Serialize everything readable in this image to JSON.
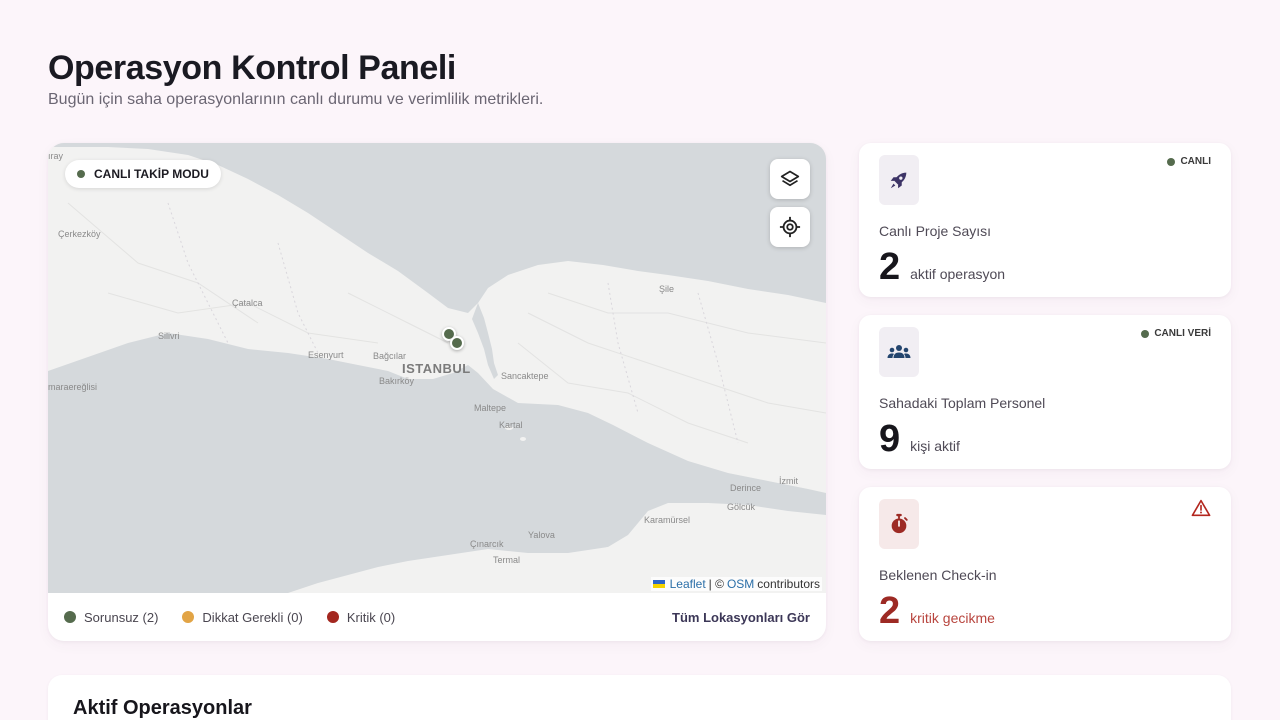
{
  "header": {
    "title": "Operasyon Kontrol Paneli",
    "subtitle": "Bugün için saha operasyonlarının canlı durumu ve verimlilik metrikleri."
  },
  "map": {
    "live_mode_label": "CANLI TAKİP MODU",
    "layers_button": "layers-icon",
    "locate_button": "crosshair-icon",
    "places": {
      "istanbul": "ISTANBUL",
      "cerkezkoy": "Çerkezköy",
      "catalca": "Çatalca",
      "silivri": "Silivri",
      "esenyurt": "Esenyurt",
      "bagcilar": "Bağcılar",
      "bakirkoy": "Bakırköy",
      "sancaktepe": "Sancaktepe",
      "maltepe": "Maltepe",
      "kartal": "Kartal",
      "sile": "Şile",
      "derince": "Derince",
      "izmit": "İzmit",
      "golcuk": "Gölcük",
      "karamursel": "Karamürsel",
      "yalova": "Yalova",
      "cinarcik": "Çınarcık",
      "termal": "Termal",
      "marmaraereglisi": "maraereğlisi",
      "tray": "ıray"
    },
    "attribution": {
      "leaflet": "Leaflet",
      "sep": "| ©",
      "osm": "OSM",
      "contributors": "contributors"
    },
    "legend": [
      {
        "label": "Sorunsuz (2)",
        "color": "#556b4d"
      },
      {
        "label": "Dikkat Gerekli (0)",
        "color": "#e2a445"
      },
      {
        "label": "Kritik (0)",
        "color": "#a3271f"
      }
    ],
    "all_locations_link": "Tüm Lokasyonları Gör"
  },
  "stats": [
    {
      "icon": "rocket-icon",
      "badge": "CANLI",
      "label": "Canlı Proje Sayısı",
      "value": "2",
      "unit": "aktif operasyon"
    },
    {
      "icon": "people-icon",
      "badge": "CANLI VERİ",
      "label": "Sahadaki Toplam Personel",
      "value": "9",
      "unit": "kişi aktif"
    },
    {
      "icon": "stopwatch-icon",
      "badge": "warning-icon",
      "label": "Beklenen Check-in",
      "value": "2",
      "unit": "kritik gecikme"
    }
  ],
  "ops": {
    "title": "Aktif Operasyonlar"
  },
  "colors": {
    "background": "#fcf5fa",
    "ok": "#556b4d",
    "warn": "#e2a445",
    "critical": "#a3271f",
    "sea": "#d5d9dc",
    "land": "#f2f2f1"
  }
}
